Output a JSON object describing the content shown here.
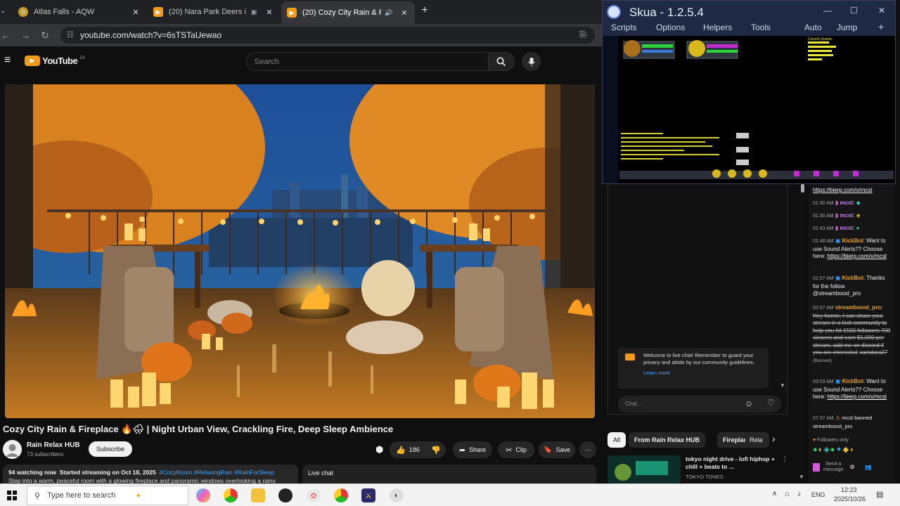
{
  "tabs": [
    {
      "label": "Atlas Falls - AQW",
      "active": false
    },
    {
      "label": "(20) Nara Park Deers in Japa",
      "active": false
    },
    {
      "label": "(20) Cozy City Rain & Firepl",
      "active": true
    }
  ],
  "address": {
    "url": "youtube.com/watch?v=6sTSTaUewao"
  },
  "youtube": {
    "logo": "YouTube",
    "logo_sup": "ZA",
    "search_placeholder": "Search"
  },
  "video": {
    "title": "Cozy City Rain & Fireplace 🔥🌧 | Night Urban View, Crackling Fire, Deep Sleep Ambience",
    "channel": "Rain Relax HUB",
    "subscribers": "73 subscribers",
    "subscribe_label": "Subscribe",
    "likes": "186",
    "share_label": "Share",
    "clip_label": "Clip",
    "save_label": "Save",
    "watching": "94 watching now",
    "started": "Started streaming on Oct 18, 2025",
    "hashtags": "#CozyRoom #RelaxingRain #RainForSleep",
    "description_preview": "Step into a warm, peaceful room with a glowing fireplace and panoramic windows overlooking a rainy",
    "live_chat_label": "Live chat"
  },
  "skua": {
    "title": "Skua - 1.2.5.4",
    "menu": [
      "Scripts",
      "Options",
      "Helpers",
      "Tools"
    ],
    "right_menu": [
      "Auto",
      "Jump",
      "+"
    ],
    "window_controls": [
      "—",
      "☐",
      "✕"
    ],
    "quest_header": "Current Quests:"
  },
  "chat": {
    "welcome": "Welcome to live chat! Remember to guard your privacy and abide by our community guidelines.",
    "learn_more": "Learn more",
    "input_placeholder": "Chat...",
    "link_partial": "https://bierp.com/x/mcst",
    "lines": [
      {
        "time": "01:30 AM",
        "user": "mcst",
        "text": ""
      },
      {
        "time": "01:30 AM",
        "user": "mcst",
        "text": ""
      },
      {
        "time": "01:43 AM",
        "user": "mcst",
        "text": ""
      },
      {
        "time": "01:48 AM",
        "user": "KickBot",
        "text": "Want to use Sound Alerts?? Choose here:",
        "link": "https://bierp.com/x/mcst"
      },
      {
        "time": "01:57 AM",
        "user": "KickBot",
        "text": "Thanks for the follow @streamboost_pro"
      },
      {
        "time": "02:57 AM",
        "user": "streamboost_pro",
        "text": "Hey homie, I can share your stream in a kick community to help you hit 1500 followers 700 viewers and earn $1,000 per stream, add me on discord if you are interested",
        "tail": "camdora27",
        "banned": "(Banned)"
      },
      {
        "time": "03:03 AM",
        "user": "KickBot",
        "text": "Want to use Sound Alerts?? Choose here:",
        "link": "https://bierp.com/x/mcst"
      },
      {
        "time": "07:37 AM",
        "user": "mcst banned streamboost_pro",
        "text": ""
      }
    ],
    "followers_only": "Followers only",
    "send_label": "Send a message"
  },
  "chips": {
    "items": [
      "All",
      "From Rain Relax HUB",
      "Fireplaces",
      "Rela"
    ]
  },
  "recommendation": {
    "title": "tokyo night drive - lofi hiphop + chill + beats to ...",
    "channel": "TOKYO TONES"
  },
  "taskbar": {
    "search_placeholder": "Type here to search",
    "lang": "ENG",
    "time": "12:23",
    "date": "2025/10/26"
  }
}
